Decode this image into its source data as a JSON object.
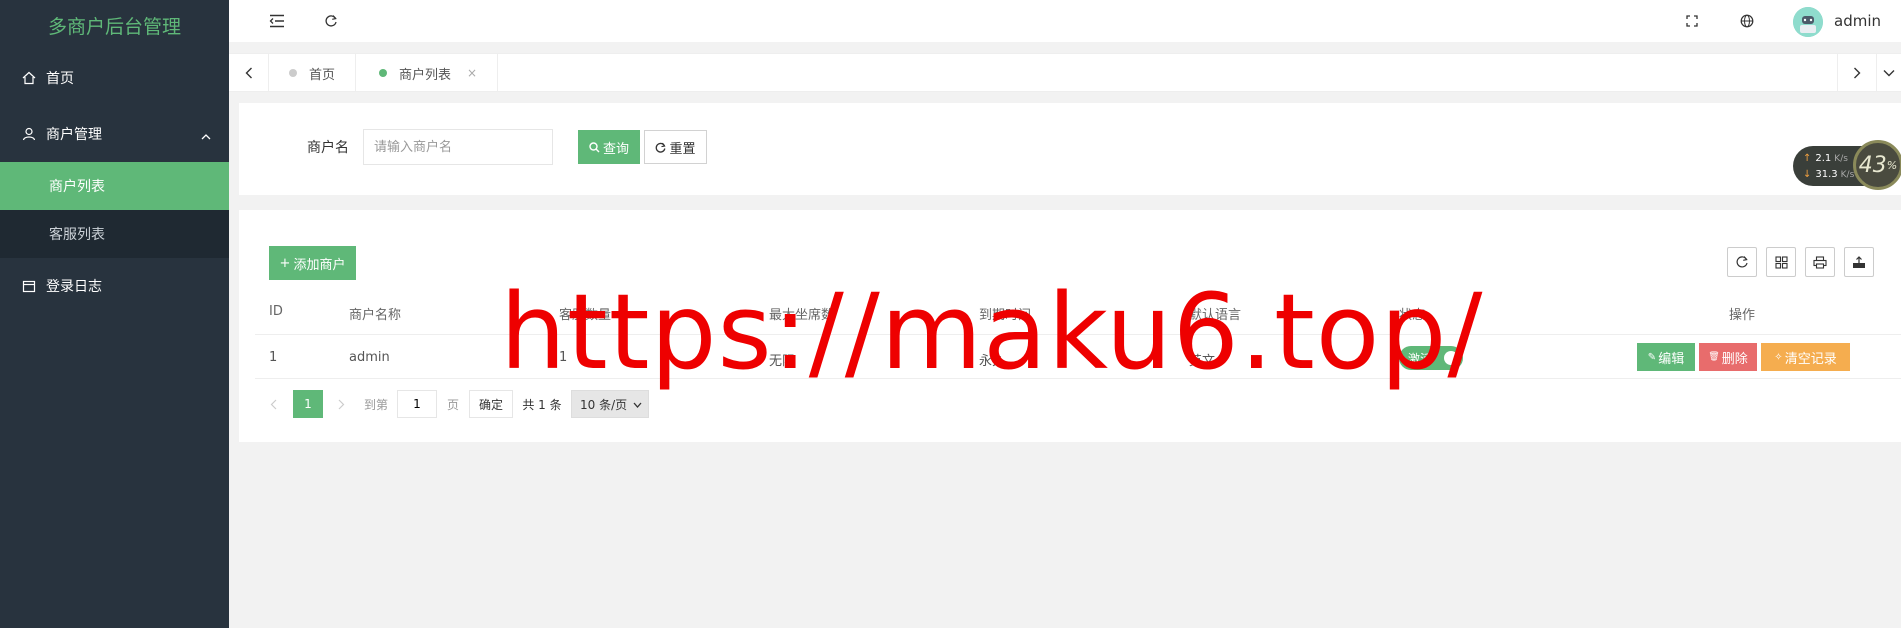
{
  "sidebar": {
    "logo": "多商户后台管理",
    "home": "首页",
    "group": "商户管理",
    "sub_items": [
      {
        "label": "商户列表"
      },
      {
        "label": "客服列表"
      }
    ],
    "logs": "登录日志"
  },
  "header": {
    "user": "admin"
  },
  "tabs": [
    {
      "label": "首页"
    },
    {
      "label": "商户列表",
      "close": "×"
    }
  ],
  "search": {
    "label": "商户名",
    "placeholder": "请输入商户名",
    "query_label": "查询",
    "reset_label": "重置"
  },
  "netspeed": {
    "up": "2.1",
    "down": "31.3",
    "unit": "K/s",
    "percent": "43",
    "percent_sign": "%"
  },
  "table": {
    "add_label": "添加商户",
    "columns": [
      "ID",
      "商户名称",
      "客服数量",
      "最大坐席数",
      "到期时间",
      "默认语言",
      "状态",
      "操作"
    ],
    "rows": [
      {
        "id": "1",
        "name": "admin",
        "kefu": "1",
        "max_seats": "无限",
        "expire": "永久",
        "lang": "英文",
        "status": "激活",
        "actions": {
          "edit": "编辑",
          "delete": "删除",
          "clear": "清空记录"
        }
      }
    ]
  },
  "pager": {
    "current": "1",
    "goto_prefix": "到第",
    "goto_value": "1",
    "goto_suffix": "页",
    "confirm": "确定",
    "total": "共 1 条",
    "page_size": "10 条/页"
  },
  "watermark": "https://maku6.top/",
  "colors": {
    "accent": "#5fb878",
    "danger": "#e86c6c",
    "warning": "#f5ad4f",
    "sidebar": "#28333e"
  }
}
